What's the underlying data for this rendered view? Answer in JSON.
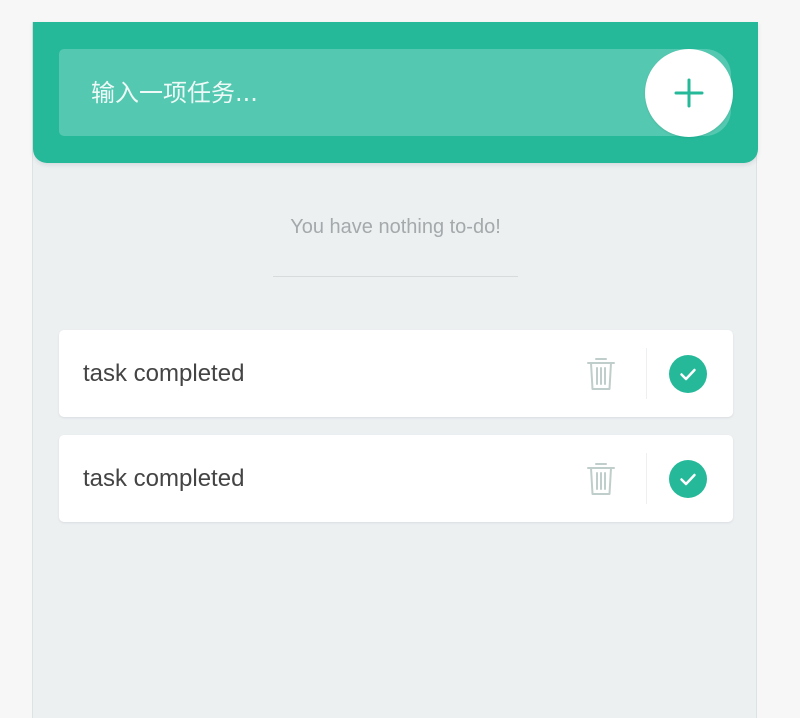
{
  "colors": {
    "accent": "#25b99a",
    "background": "#edf0f1",
    "card": "#ffffff",
    "muted_text": "#a4a9ab",
    "text": "#444444"
  },
  "header": {
    "input_placeholder": "输入一项任务...",
    "input_value": "",
    "add_button_icon": "plus-icon"
  },
  "todo_section": {
    "empty_message": "You have nothing to-do!"
  },
  "completed_items": [
    {
      "text": "task completed",
      "delete_icon": "trash-icon",
      "complete_icon": "check-circle-icon",
      "completed": true
    },
    {
      "text": "task completed",
      "delete_icon": "trash-icon",
      "complete_icon": "check-circle-icon",
      "completed": true
    }
  ]
}
